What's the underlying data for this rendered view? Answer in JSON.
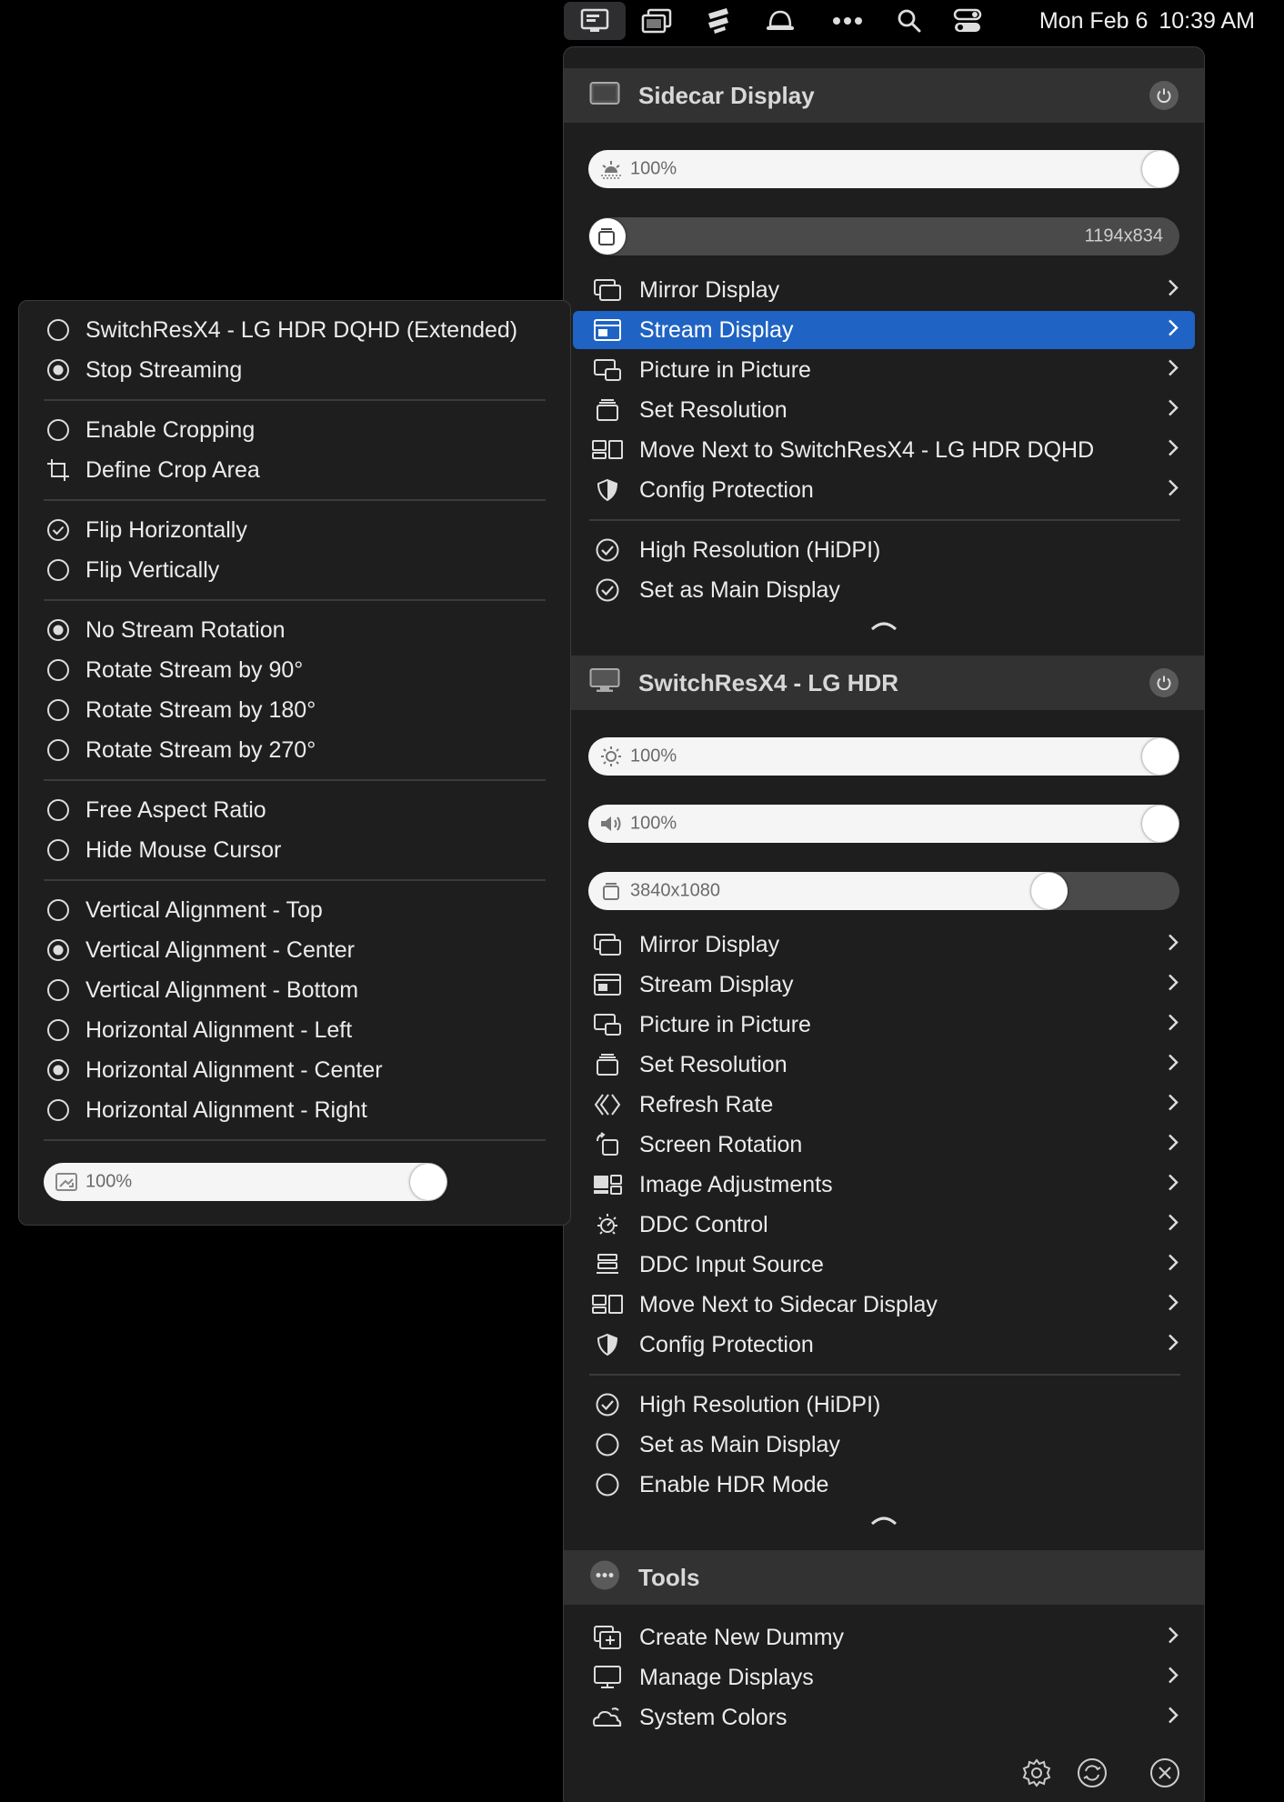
{
  "menubar": {
    "icons": [
      "display-menu-icon",
      "window-stack-icon",
      "app-icon",
      "bell-icon",
      "more-icon",
      "search-icon",
      "control-center-icon"
    ],
    "date": "Mon Feb 6",
    "time": "10:39 AM"
  },
  "sidecar": {
    "title": "Sidecar Display",
    "brightness": "100%",
    "brightness_level": 1.0,
    "resolution": "1194x834",
    "items": [
      {
        "label": "Mirror Display",
        "icon": "mirror-icon"
      },
      {
        "label": "Stream Display",
        "icon": "stream-icon",
        "selected": true
      },
      {
        "label": "Picture in Picture",
        "icon": "pip-icon"
      },
      {
        "label": "Set Resolution",
        "icon": "resolution-icon"
      },
      {
        "label": "Move Next to SwitchResX4 - LG HDR DQHD",
        "icon": "move-next-icon"
      },
      {
        "label": "Config Protection",
        "icon": "shield-icon"
      }
    ],
    "toggles": [
      {
        "label": "High Resolution (HiDPI)",
        "checked": true
      },
      {
        "label": "Set as Main Display",
        "checked": true
      }
    ]
  },
  "lg": {
    "title": "SwitchResX4 - LG HDR",
    "brightness": "100%",
    "volume": "100%",
    "resolution": "3840x1080",
    "resolution_level": 0.78,
    "items": [
      {
        "label": "Mirror Display",
        "icon": "mirror-icon"
      },
      {
        "label": "Stream Display",
        "icon": "stream-icon"
      },
      {
        "label": "Picture in Picture",
        "icon": "pip-icon"
      },
      {
        "label": "Set Resolution",
        "icon": "resolution-icon"
      },
      {
        "label": "Refresh Rate",
        "icon": "refresh-rate-icon"
      },
      {
        "label": "Screen Rotation",
        "icon": "rotation-icon"
      },
      {
        "label": "Image Adjustments",
        "icon": "image-adjust-icon"
      },
      {
        "label": "DDC Control",
        "icon": "ddc-control-icon"
      },
      {
        "label": "DDC Input Source",
        "icon": "input-source-icon"
      },
      {
        "label": "Move Next to Sidecar Display",
        "icon": "move-next-icon"
      },
      {
        "label": "Config Protection",
        "icon": "shield-icon"
      }
    ],
    "toggles": [
      {
        "label": "High Resolution (HiDPI)",
        "checked": true
      },
      {
        "label": "Set as Main Display",
        "checked": false
      },
      {
        "label": "Enable HDR Mode",
        "checked": false
      }
    ]
  },
  "tools": {
    "title": "Tools",
    "items": [
      {
        "label": "Create New Dummy",
        "icon": "create-dummy-icon"
      },
      {
        "label": "Manage Displays",
        "icon": "manage-displays-icon"
      },
      {
        "label": "System Colors",
        "icon": "system-colors-icon"
      }
    ],
    "footer": [
      "settings-gear-icon",
      "refresh-icon",
      "quit-icon"
    ]
  },
  "submenu": {
    "groups": [
      [
        {
          "label": "SwitchResX4 - LG HDR DQHD (Extended)",
          "state": "off"
        },
        {
          "label": "Stop Streaming",
          "state": "on"
        }
      ],
      [
        {
          "label": "Enable Cropping",
          "state": "off"
        },
        {
          "label": "Define Crop Area",
          "state": "crop"
        }
      ],
      [
        {
          "label": "Flip Horizontally",
          "state": "check"
        },
        {
          "label": "Flip Vertically",
          "state": "off"
        }
      ],
      [
        {
          "label": "No Stream Rotation",
          "state": "on"
        },
        {
          "label": "Rotate Stream by 90°",
          "state": "off"
        },
        {
          "label": "Rotate Stream by 180°",
          "state": "off"
        },
        {
          "label": "Rotate Stream by 270°",
          "state": "off"
        }
      ],
      [
        {
          "label": "Free Aspect Ratio",
          "state": "off"
        },
        {
          "label": "Hide Mouse Cursor",
          "state": "off"
        }
      ],
      [
        {
          "label": "Vertical Alignment - Top",
          "state": "off"
        },
        {
          "label": "Vertical Alignment - Center",
          "state": "on"
        },
        {
          "label": "Vertical Alignment - Bottom",
          "state": "off"
        },
        {
          "label": "Horizontal Alignment - Left",
          "state": "off"
        },
        {
          "label": "Horizontal Alignment - Center",
          "state": "on"
        },
        {
          "label": "Horizontal Alignment - Right",
          "state": "off"
        }
      ]
    ],
    "scale": "100%",
    "scale_level": 1.0
  },
  "colors": {
    "accent": "#1f63c4",
    "panel": "#1e1e1e",
    "header": "#323232"
  }
}
